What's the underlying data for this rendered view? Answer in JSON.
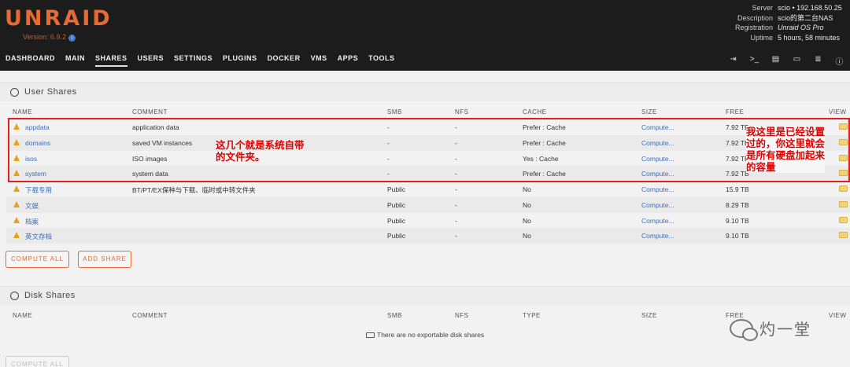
{
  "brand": {
    "logo": "UNRAID",
    "version": "Version: 6.9.2"
  },
  "server_info": [
    {
      "key": "Server",
      "value": "scio • 192.168.50.25"
    },
    {
      "key": "Description",
      "value": "scio的第二台NAS"
    },
    {
      "key": "Registration",
      "value": "Unraid OS Pro"
    },
    {
      "key": "Uptime",
      "value": "5 hours, 58 minutes"
    }
  ],
  "nav": [
    "DASHBOARD",
    "MAIN",
    "SHARES",
    "USERS",
    "SETTINGS",
    "PLUGINS",
    "DOCKER",
    "VMS",
    "APPS",
    "TOOLS"
  ],
  "nav_active": "SHARES",
  "nav_icons": [
    "logout-icon",
    "terminal-icon",
    "feedback-icon",
    "display-icon",
    "log-icon",
    "info-icon"
  ],
  "user_shares": {
    "title": "User Shares",
    "columns": [
      "NAME",
      "COMMENT",
      "SMB",
      "NFS",
      "CACHE",
      "SIZE",
      "FREE",
      "VIEW"
    ],
    "rows": [
      {
        "name": "appdata",
        "comment": "application data",
        "smb": "-",
        "nfs": "-",
        "cache": "Prefer : Cache",
        "size": "Compute...",
        "free": "7.92 TB"
      },
      {
        "name": "domains",
        "comment": "saved VM instances",
        "smb": "-",
        "nfs": "-",
        "cache": "Prefer : Cache",
        "size": "Compute...",
        "free": "7.92 TB"
      },
      {
        "name": "isos",
        "comment": "ISO images",
        "smb": "-",
        "nfs": "-",
        "cache": "Yes : Cache",
        "size": "Compute...",
        "free": "7.92 TB"
      },
      {
        "name": "system",
        "comment": "system data",
        "smb": "-",
        "nfs": "-",
        "cache": "Prefer : Cache",
        "size": "Compute...",
        "free": "7.92 TB"
      },
      {
        "name": "下载专用",
        "comment": "BT/PT/EX保种与下载、临时或中转文件夹",
        "smb": "Public",
        "nfs": "-",
        "cache": "No",
        "size": "Compute...",
        "free": "15.9 TB"
      },
      {
        "name": "文娱",
        "comment": "",
        "smb": "Public",
        "nfs": "-",
        "cache": "No",
        "size": "Compute...",
        "free": "8.29 TB"
      },
      {
        "name": "档案",
        "comment": "",
        "smb": "Public",
        "nfs": "-",
        "cache": "No",
        "size": "Compute...",
        "free": "9.10 TB"
      },
      {
        "name": "英文存档",
        "comment": "",
        "smb": "Public",
        "nfs": "-",
        "cache": "No",
        "size": "Compute...",
        "free": "9.10 TB"
      }
    ],
    "buttons": {
      "compute_all": "COMPUTE ALL",
      "add_share": "ADD SHARE"
    }
  },
  "disk_shares": {
    "title": "Disk Shares",
    "columns": [
      "NAME",
      "COMMENT",
      "SMB",
      "NFS",
      "TYPE",
      "SIZE",
      "FREE",
      "VIEW"
    ],
    "empty_message": "There are no exportable disk shares",
    "buttons": {
      "compute_all": "COMPUTE ALL"
    }
  },
  "annotations": {
    "left": "这几个就是系统自带的文件夹。",
    "right": "我这里是已经设置过的，你这里就会是所有硬盘加起来的容量"
  },
  "watermark": "灼一堂"
}
